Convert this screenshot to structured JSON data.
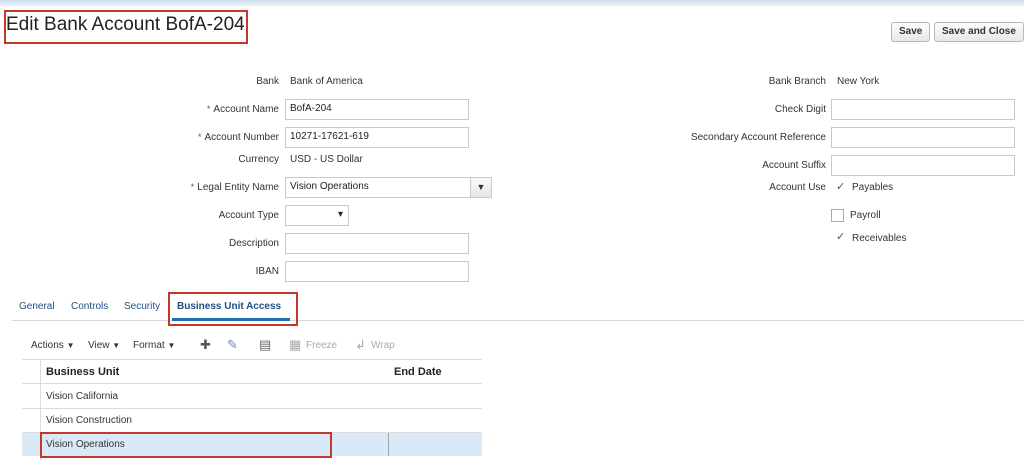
{
  "page": {
    "title": "Edit Bank Account BofA-204"
  },
  "toolbar": {
    "save_label": "Save",
    "save_close_label": "Save and Close"
  },
  "form": {
    "bank": {
      "label": "Bank",
      "value": "Bank of America"
    },
    "account_name": {
      "label": "Account Name",
      "value": "BofA-204"
    },
    "account_number": {
      "label": "Account Number",
      "value": "10271-17621-619"
    },
    "currency": {
      "label": "Currency",
      "value": "USD - US Dollar"
    },
    "legal_entity": {
      "label": "Legal Entity Name",
      "value": "Vision Operations"
    },
    "account_type": {
      "label": "Account Type",
      "value": ""
    },
    "description": {
      "label": "Description",
      "value": ""
    },
    "iban": {
      "label": "IBAN",
      "value": ""
    },
    "bank_branch": {
      "label": "Bank Branch",
      "value": "New York"
    },
    "check_digit": {
      "label": "Check Digit",
      "value": ""
    },
    "secondary_ref": {
      "label": "Secondary Account Reference",
      "value": ""
    },
    "account_suffix": {
      "label": "Account Suffix",
      "value": ""
    },
    "account_use": {
      "label": "Account Use",
      "options": [
        {
          "label": "Payables",
          "checked": true
        },
        {
          "label": "Payroll",
          "checked": false
        },
        {
          "label": "Receivables",
          "checked": true
        }
      ]
    },
    "required_marker": "*"
  },
  "tabs": [
    {
      "label": "General"
    },
    {
      "label": "Controls"
    },
    {
      "label": "Security"
    },
    {
      "label": "Business Unit Access",
      "active": true
    }
  ],
  "table_toolbar": {
    "actions": "Actions",
    "view": "View",
    "format": "Format",
    "freeze": "Freeze",
    "wrap": "Wrap",
    "dropdown_glyph": "▼",
    "add_glyph": "✚",
    "edit_glyph": "✎",
    "detach_glyph": "▤",
    "freeze_glyph": "▦",
    "wrap_glyph": "↲"
  },
  "table": {
    "columns": [
      "Business Unit",
      "End Date"
    ],
    "rows": [
      {
        "business_unit": "Vision California",
        "end_date": ""
      },
      {
        "business_unit": "Vision Construction",
        "end_date": ""
      },
      {
        "business_unit": "Vision Operations",
        "end_date": "",
        "selected": true
      }
    ]
  },
  "glyphs": {
    "check": "✓",
    "select_arrow": "▾",
    "dropdown": "▼"
  },
  "colors": {
    "accent": "#1f6fb2",
    "highlight_box": "#c0392b",
    "selected_row": "#d9e9f7"
  }
}
